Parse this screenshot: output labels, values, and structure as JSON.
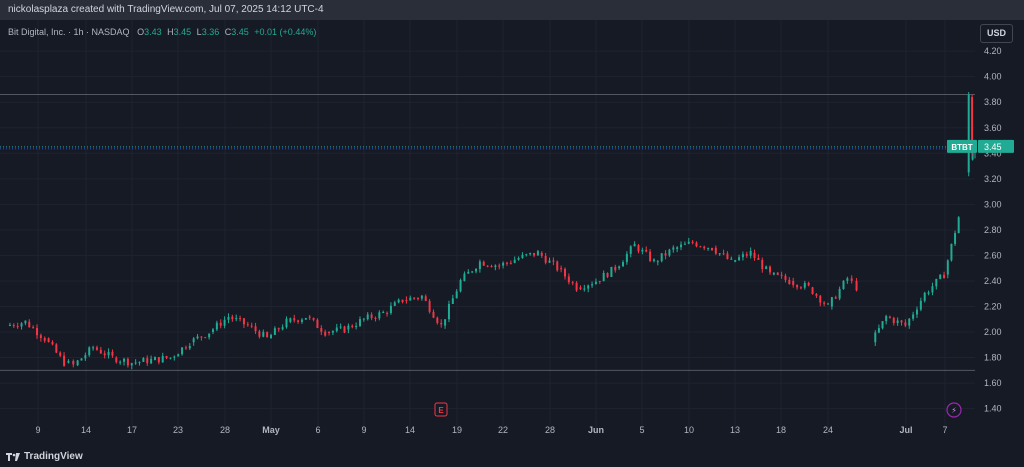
{
  "header": {
    "attribution": "nickolasplaza created with TradingView.com, Jul 07, 2025 14:12 UTC-4"
  },
  "legend": {
    "symbol": "Bit Digital, Inc. · 1h · NASDAQ",
    "o_label": "O",
    "o_value": "3.43",
    "h_label": "H",
    "h_value": "3.45",
    "l_label": "L",
    "l_value": "3.36",
    "c_label": "C",
    "c_value": "3.45",
    "change": "+0.01 (+0.44%)"
  },
  "currency": "USD",
  "footer": {
    "brand": "TradingView"
  },
  "colors": {
    "up": "#22ab94",
    "down": "#f23645",
    "background": "#161a25",
    "grid": "#1f2330",
    "axis_text": "#b2b5be",
    "price_tag": "#22ab94"
  },
  "chart_data": {
    "type": "candlestick",
    "symbol": "BTBT",
    "last_price": 3.45,
    "last_price_label": "3.45",
    "ylim": [
      1.35,
      4.35
    ],
    "y_ticks": [
      "1.40",
      "1.60",
      "1.80",
      "2.00",
      "2.20",
      "2.40",
      "2.60",
      "2.80",
      "3.00",
      "3.20",
      "3.40",
      "3.60",
      "3.80",
      "4.00",
      "4.20"
    ],
    "x_tick_labels": [
      "9",
      "14",
      "17",
      "23",
      "28",
      "May",
      "6",
      "9",
      "14",
      "19",
      "22",
      "28",
      "Jun",
      "5",
      "10",
      "13",
      "18",
      "24",
      "Jul",
      "7"
    ],
    "horizontal_lines": [
      3.86,
      1.7
    ],
    "event_markers": [
      {
        "label": "E",
        "type": "earnings"
      },
      {
        "label": "⚡",
        "type": "dividend"
      }
    ],
    "trend_path": [
      [
        0.0,
        2.05
      ],
      [
        0.02,
        2.08
      ],
      [
        0.04,
        1.95
      ],
      [
        0.06,
        1.76
      ],
      [
        0.07,
        1.74
      ],
      [
        0.09,
        1.88
      ],
      [
        0.11,
        1.8
      ],
      [
        0.13,
        1.76
      ],
      [
        0.15,
        1.78
      ],
      [
        0.17,
        1.8
      ],
      [
        0.19,
        1.92
      ],
      [
        0.21,
        2.0
      ],
      [
        0.23,
        2.12
      ],
      [
        0.25,
        2.05
      ],
      [
        0.27,
        1.95
      ],
      [
        0.29,
        2.08
      ],
      [
        0.31,
        2.12
      ],
      [
        0.33,
        2.0
      ],
      [
        0.35,
        2.02
      ],
      [
        0.37,
        2.1
      ],
      [
        0.39,
        2.15
      ],
      [
        0.41,
        2.25
      ],
      [
        0.43,
        2.28
      ],
      [
        0.45,
        2.05
      ],
      [
        0.47,
        2.4
      ],
      [
        0.49,
        2.55
      ],
      [
        0.51,
        2.52
      ],
      [
        0.53,
        2.58
      ],
      [
        0.55,
        2.62
      ],
      [
        0.57,
        2.5
      ],
      [
        0.59,
        2.35
      ],
      [
        0.61,
        2.4
      ],
      [
        0.63,
        2.5
      ],
      [
        0.65,
        2.68
      ],
      [
        0.67,
        2.55
      ],
      [
        0.69,
        2.65
      ],
      [
        0.71,
        2.7
      ],
      [
        0.73,
        2.66
      ],
      [
        0.75,
        2.55
      ],
      [
        0.77,
        2.62
      ],
      [
        0.79,
        2.45
      ],
      [
        0.81,
        2.4
      ],
      [
        0.83,
        2.35
      ],
      [
        0.85,
        2.2
      ],
      [
        0.87,
        2.42
      ],
      [
        0.88,
        2.35
      ],
      [
        0.885,
        null
      ],
      [
        0.895,
        1.92
      ],
      [
        0.91,
        2.12
      ],
      [
        0.93,
        2.05
      ],
      [
        0.95,
        2.3
      ],
      [
        0.97,
        2.45
      ],
      [
        0.985,
        2.9
      ],
      [
        0.99,
        null
      ],
      [
        0.995,
        3.35
      ],
      [
        1.0,
        3.45
      ]
    ]
  }
}
